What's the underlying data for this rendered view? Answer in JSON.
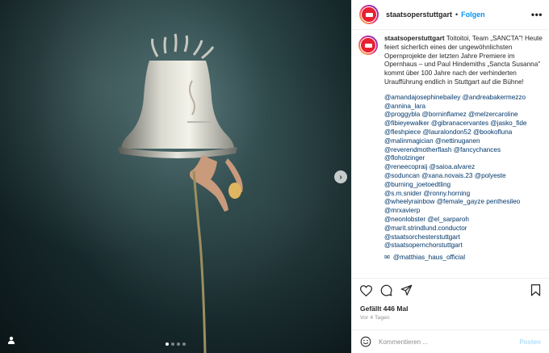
{
  "post": {
    "account": "staatsoperstuttgart",
    "separator": "•",
    "follow_label": "Folgen",
    "more_label": "•••",
    "caption": {
      "username": "staatsoperstuttgart",
      "text": "Toitoitoi, Team „SANCTA\"! Heute feiert sicherlich eines der ungewöhnlichsten Opernprojekte der letzten Jahre Premiere im Opernhaus – und Paul Hindemiths „Sancta Susanna\" kommt über 100 Jahre nach der verhinderten Uraufführung endlich in Stuttgart auf die Bühne!"
    },
    "tags": [
      "@amandajosephinebailey @andreabakermezzo",
      "@annina_lara",
      "@proggybla @borninflamez @melzercaroline",
      "@fibieyewalker @gibranacervantes @jasko_fide",
      "@fleshpiece @lauralondon52 @bookofluna",
      "@malinmagician @nettinuganen",
      "@reverendmotherflash @fancychances",
      "@floholzinger",
      "@reneecopraij @saioa.alvarez",
      "@soduncan @xana.novais.23 @polyeste",
      "@burning_joetoedtling",
      "@s.m.snider @ronny.horning",
      "@wheelyrainbow @female_gayze penthesileo",
      "@mrxavierp",
      "@neonlobster @el_sarparoh",
      "@marit.strindlund.conductor",
      "@staatsorchesterstuttgart",
      "@staatsopernchorstuttgart"
    ],
    "partial_tag": "@matthias_haus_official",
    "likes": "Gefällt 446 Mal",
    "date": "Vor 4 Tagen",
    "comment_placeholder": "Kommentieren ...",
    "post_button": "Posten"
  },
  "media": {
    "next_label": "›",
    "carousel_count": 4,
    "carousel_active": 1
  },
  "icons": [
    "heart-icon",
    "comment-icon",
    "share-icon",
    "bookmark-icon",
    "emoji-icon",
    "user-tag-icon",
    "chevron-right-icon"
  ],
  "colors": {
    "accent": "#0095f6",
    "brand": "#e8202f",
    "link": "#00376b",
    "muted": "#8e8e8e"
  }
}
